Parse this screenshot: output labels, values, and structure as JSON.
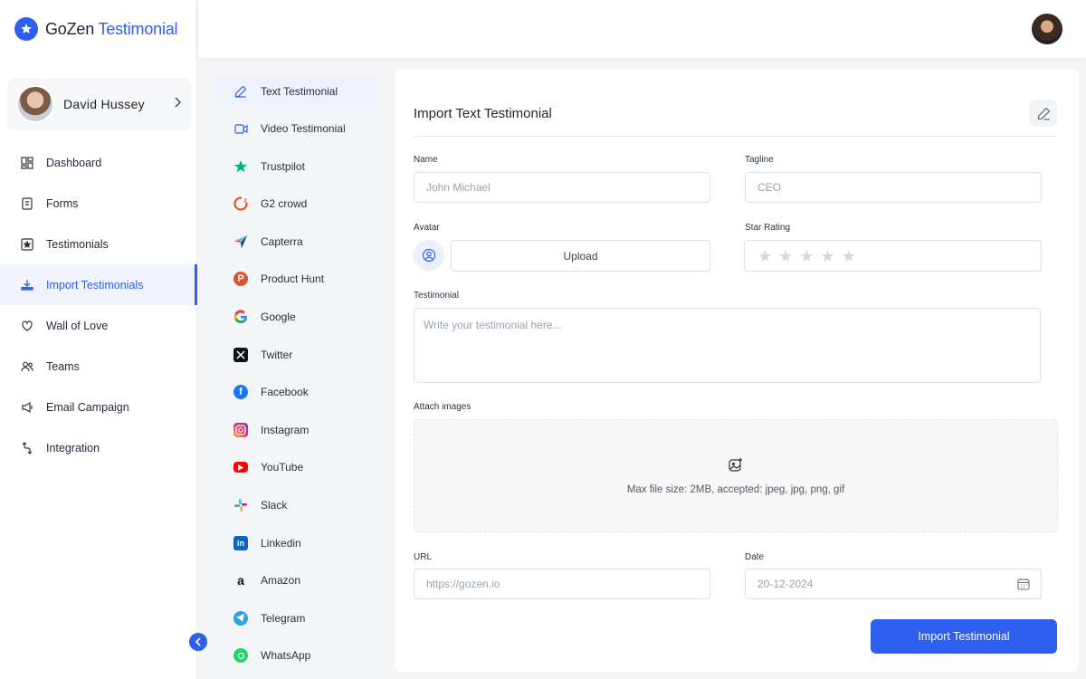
{
  "brand": {
    "name_part1": "GoZen",
    "name_part2": "Testimonial",
    "color": "#2f5ff0"
  },
  "user": {
    "name": "David Hussey"
  },
  "nav": {
    "items": [
      {
        "label": "Dashboard",
        "icon": "dashboard-icon"
      },
      {
        "label": "Forms",
        "icon": "forms-icon"
      },
      {
        "label": "Testimonials",
        "icon": "testimonials-icon"
      },
      {
        "label": "Import Testimonials",
        "icon": "import-icon",
        "active": true
      },
      {
        "label": "Wall of Love",
        "icon": "wall-of-love-icon"
      },
      {
        "label": "Teams",
        "icon": "teams-icon"
      },
      {
        "label": "Email Campaign",
        "icon": "email-campaign-icon"
      },
      {
        "label": "Integration",
        "icon": "integration-icon"
      }
    ]
  },
  "sources": {
    "items": [
      {
        "label": "Text Testimonial",
        "icon": "pencil-icon",
        "active": true
      },
      {
        "label": "Video Testimonial",
        "icon": "video-icon"
      },
      {
        "label": "Trustpilot",
        "icon": "trustpilot-icon"
      },
      {
        "label": "G2 crowd",
        "icon": "g2-icon"
      },
      {
        "label": "Capterra",
        "icon": "capterra-icon"
      },
      {
        "label": "Product Hunt",
        "icon": "product-hunt-icon"
      },
      {
        "label": "Google",
        "icon": "google-icon"
      },
      {
        "label": "Twitter",
        "icon": "twitter-x-icon"
      },
      {
        "label": "Facebook",
        "icon": "facebook-icon"
      },
      {
        "label": "Instagram",
        "icon": "instagram-icon"
      },
      {
        "label": "YouTube",
        "icon": "youtube-icon"
      },
      {
        "label": "Slack",
        "icon": "slack-icon"
      },
      {
        "label": "Linkedin",
        "icon": "linkedin-icon"
      },
      {
        "label": "Amazon",
        "icon": "amazon-icon"
      },
      {
        "label": "Telegram",
        "icon": "telegram-icon"
      },
      {
        "label": "WhatsApp",
        "icon": "whatsapp-icon"
      }
    ]
  },
  "form": {
    "title": "Import Text Testimonial",
    "name": {
      "label": "Name",
      "placeholder": "John Michael"
    },
    "tagline": {
      "label": "Tagline",
      "placeholder": "CEO"
    },
    "avatar": {
      "label": "Avatar",
      "upload_label": "Upload"
    },
    "rating": {
      "label": "Star Rating",
      "value": 0,
      "max": 5
    },
    "testimonial": {
      "label": "Testimonial",
      "placeholder": "Write your testimonial here..."
    },
    "attach": {
      "label": "Attach images",
      "hint": "Max file size: 2MB, accepted: jpeg, jpg, png, gif"
    },
    "url": {
      "label": "URL",
      "placeholder": "https://gozen.io"
    },
    "date": {
      "label": "Date",
      "value": "20-12-2024"
    },
    "submit_label": "Import Testimonial"
  }
}
